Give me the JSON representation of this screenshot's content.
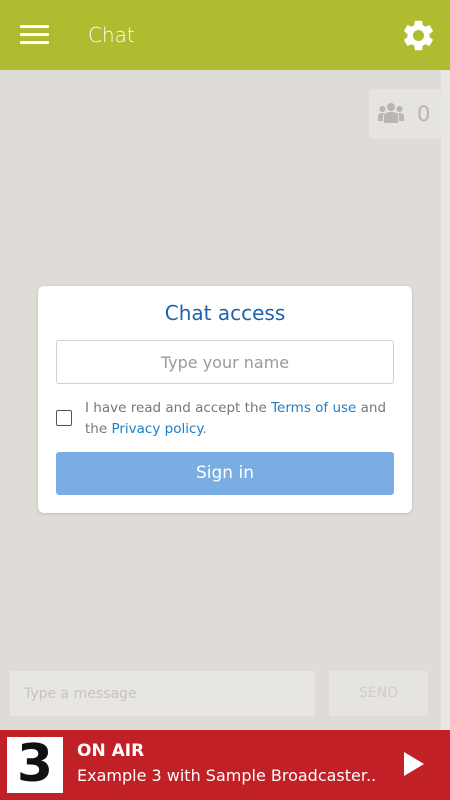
{
  "appbar": {
    "title": "Chat",
    "menu_icon": "hamburger-menu-icon",
    "settings_icon": "gear-icon",
    "color": "#afbc2f"
  },
  "users_online": {
    "icon": "users-group-icon",
    "count": "0"
  },
  "chat_access": {
    "title": "Chat access",
    "name_placeholder": "Type your name",
    "terms_prefix": "I have read and accept the ",
    "terms_link": "Terms of use",
    "terms_middle": " and the ",
    "privacy_link": "Privacy policy",
    "terms_suffix": ".",
    "accepted": false,
    "signin_label": "Sign in",
    "accent_color": "#7aaee3"
  },
  "composer": {
    "message_placeholder": "Type a message",
    "send_label": "SEND"
  },
  "player": {
    "logo_text": "3",
    "status": "ON AIR",
    "now_playing": "Example 3 with Sample Broadcaster..",
    "play_icon": "play-icon",
    "color": "#c12027"
  }
}
